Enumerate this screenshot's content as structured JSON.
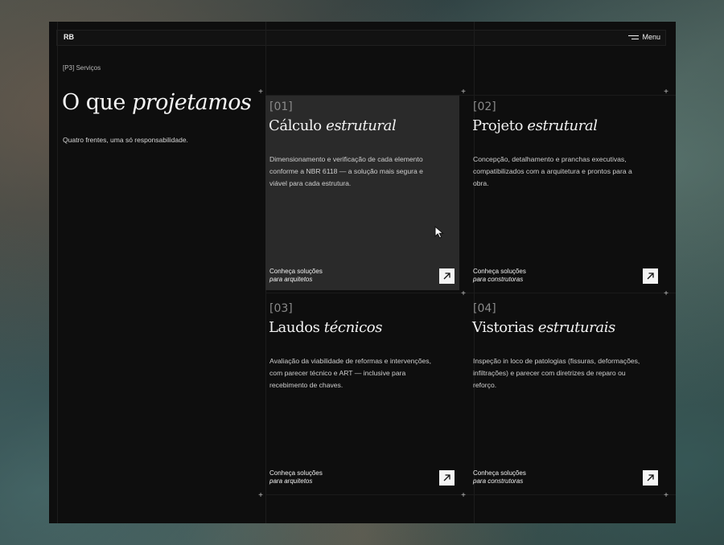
{
  "topbar": {
    "logo": "RB",
    "menu_label": "Menu"
  },
  "intro": {
    "tag": "[P3] Serviços",
    "heading_plain": "O que ",
    "heading_italic": "projetamos",
    "subtitle": "Quatro frentes, uma só responsabilidade."
  },
  "cards": [
    {
      "number": "[01]",
      "title_plain": "Cálculo ",
      "title_italic": "estrutural",
      "description": "Dimensionamento e verificação de cada elemento conforme a NBR 6118 — a solução mais segura e viável para cada estrutura.",
      "cta_line1": "Conheça soluções",
      "cta_line2": "para arquitetos"
    },
    {
      "number": "[02]",
      "title_plain": "Projeto ",
      "title_italic": "estrutural",
      "description": "Concepção, detalhamento e pranchas executivas, compatibilizados com a arquitetura e prontos para a obra.",
      "cta_line1": "Conheça soluções",
      "cta_line2": "para construtoras"
    },
    {
      "number": "[03]",
      "title_plain": "Laudos ",
      "title_italic": "técnicos",
      "description": "Avaliação da viabilidade de reformas e intervenções, com parecer técnico e ART — inclusive para recebimento de chaves.",
      "cta_line1": "Conheça soluções",
      "cta_line2": "para arquitetos"
    },
    {
      "number": "[04]",
      "title_plain": "Vistorias ",
      "title_italic": "estruturais",
      "description": "Inspeção in loco de patologias (fissuras, deformações, infiltrações) e parecer com diretrizes de reparo ou reforço.",
      "cta_line1": "Conheça soluções",
      "cta_line2": "para construtoras"
    }
  ],
  "icons": {
    "menu": "hamburger-icon",
    "card_arrow": "arrow-up-right-icon",
    "cursor": "mouse-pointer-icon",
    "grid_marker": "plus-icon"
  },
  "plus_glyph": "+",
  "colors": {
    "window_bg": "#0e0e0e",
    "active_card": "#2a2a2a",
    "text": "#f2f2f2",
    "muted": "#8a8a8a"
  }
}
